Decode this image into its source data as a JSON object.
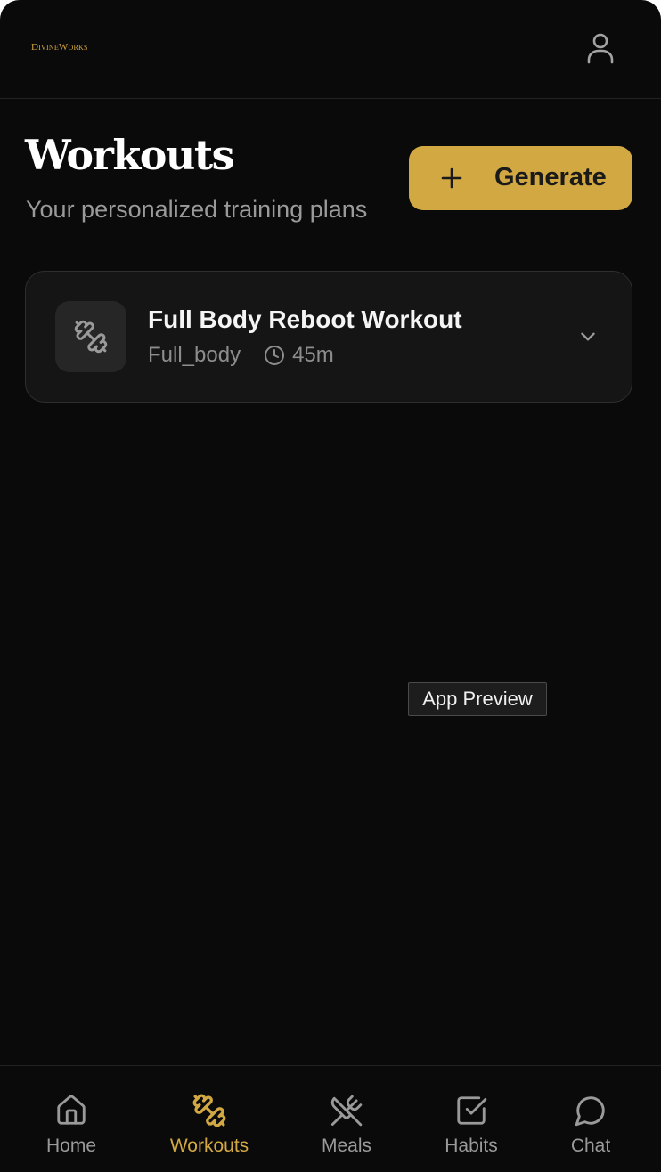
{
  "header": {
    "logo_text": "DivineWorks",
    "profile_icon": "user-icon"
  },
  "page": {
    "title": "Workouts",
    "subtitle": "Your personalized training plans",
    "generate_label": "Generate",
    "generate_icon": "plus-icon"
  },
  "workouts": [
    {
      "title": "Full Body Reboot Workout",
      "category": "Full_body",
      "duration": "45m",
      "icon": "dumbbell-icon",
      "expand_icon": "chevron-down-icon"
    }
  ],
  "tooltip": {
    "label": "App Preview"
  },
  "nav": {
    "items": [
      {
        "label": "Home",
        "icon": "home-icon",
        "active": false
      },
      {
        "label": "Workouts",
        "icon": "dumbbell-icon",
        "active": true
      },
      {
        "label": "Meals",
        "icon": "utensils-crossed-icon",
        "active": false
      },
      {
        "label": "Habits",
        "icon": "checkbox-icon",
        "active": false
      },
      {
        "label": "Chat",
        "icon": "chat-bubble-icon",
        "active": false
      }
    ]
  },
  "colors": {
    "background": "#0a0a0a",
    "accent": "#d2a843",
    "card": "#151515",
    "muted_text": "#9a9a9a"
  }
}
